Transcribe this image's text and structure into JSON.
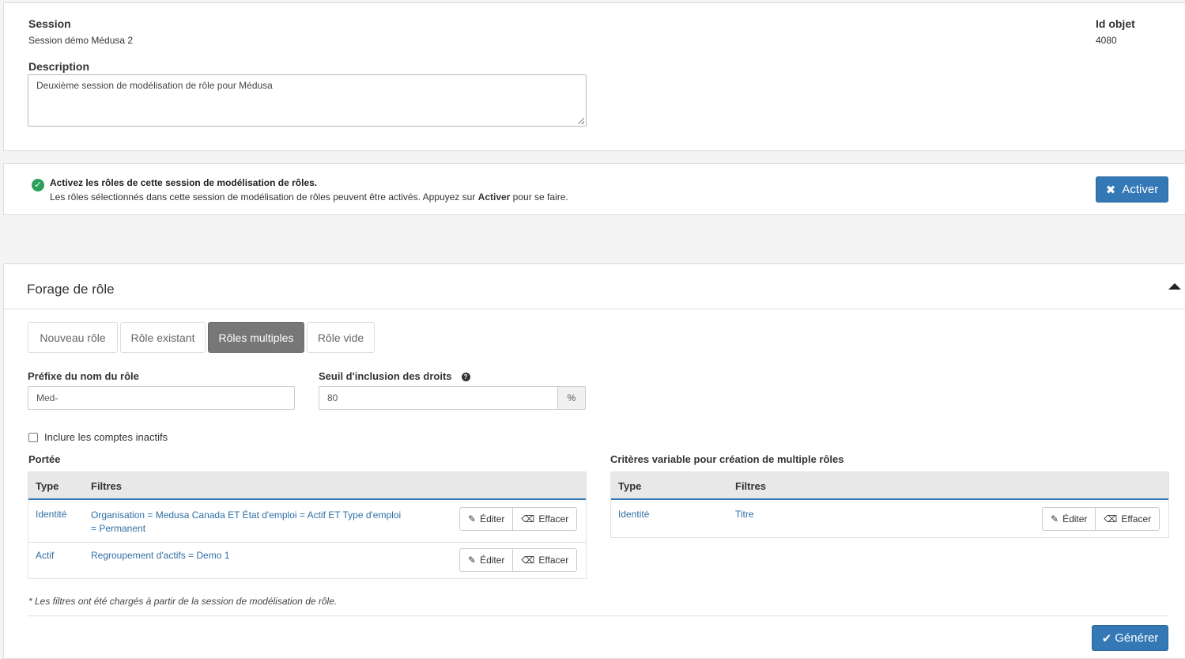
{
  "session": {
    "label": "Session",
    "value": "Session démo Médusa 2",
    "id_label": "Id objet",
    "id_value": "4080",
    "description_label": "Description",
    "description_value": "Deuxième session de modélisation de rôle pour Médusa"
  },
  "activation": {
    "title": "Activez les rôles de cette session de modélisation de rôles.",
    "text_before": "Les rôles sélectionnés dans cette session de modélisation de rôles peuvent être activés. Appuyez sur ",
    "text_bold": "Activer",
    "text_after": " pour se faire.",
    "button_label": "Activer",
    "status_color": "#2ca05a"
  },
  "forage": {
    "title": "Forage de rôle",
    "tabs": [
      {
        "label": "Nouveau rôle",
        "active": false
      },
      {
        "label": "Rôle existant",
        "active": false
      },
      {
        "label": "Rôles multiples",
        "active": true
      },
      {
        "label": "Rôle vide",
        "active": false
      }
    ],
    "prefix_label": "Préfixe du nom du rôle",
    "prefix_value": "Med-",
    "threshold_label": "Seuil d'inclusion des droits",
    "threshold_value": "80",
    "threshold_unit": "%",
    "include_inactive_label": "Inclure les comptes inactifs",
    "include_inactive_checked": false,
    "scope": {
      "title": "Portée",
      "headers": [
        "Type",
        "Filtres"
      ],
      "rows": [
        {
          "type": "Identité",
          "filter_line1": "Organisation = Medusa Canada ET État d'emploi = Actif ET Type d'emploi",
          "filter_line2": "= Permanent"
        },
        {
          "type": "Actif",
          "filter_line1": "Regroupement d'actifs = Demo 1",
          "filter_line2": ""
        }
      ]
    },
    "criteria": {
      "title": "Critères variable pour création de multiple rôles",
      "headers": [
        "Type",
        "Filtres"
      ],
      "rows": [
        {
          "type": "Identité",
          "filter": "Titre"
        }
      ]
    },
    "edit_label": "Éditer",
    "clear_label": "Effacer",
    "footnote": "* Les filtres ont été chargés à partir de la session de modélisation de rôle.",
    "generate_label": "Générer",
    "accent_color": "#3478b6"
  }
}
